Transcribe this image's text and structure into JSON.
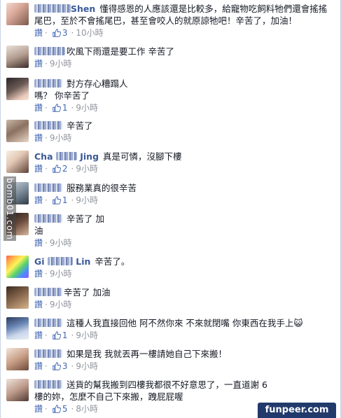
{
  "comments": [
    {
      "name_suffix": "Shen",
      "text": "懂得感恩的人應該還是比較多，給寵物吃飼料牠們還會搖搖尾巴，至於不會搖尾巴，甚至會咬人的就原諒牠吧！辛苦了，加油！",
      "like_label": "讚",
      "like_count": "3",
      "time": "10小時"
    },
    {
      "name_suffix": "",
      "text": "吹風下雨還是要工作 辛苦了",
      "like_label": "讚",
      "like_count": "",
      "time": "9小時"
    },
    {
      "name_suffix": "",
      "text": "對方存心糟蹋人嗎？ 你辛苦了",
      "like_label": "讚",
      "like_count": "1",
      "time": "9小時"
    },
    {
      "name_suffix": "",
      "text": "辛苦了",
      "like_label": "讚",
      "like_count": "",
      "time": "9小時"
    },
    {
      "name_prefix": "Cha",
      "name_suffix": "Jing",
      "text": "真是可憐，沒腳下樓",
      "like_label": "讚",
      "like_count": "2",
      "time": "9小時"
    },
    {
      "name_suffix": "",
      "text": "服務業真的很辛苦",
      "like_label": "讚",
      "like_count": "1",
      "time": "9小時"
    },
    {
      "name_suffix": "",
      "text": "辛苦了 加油",
      "like_label": "讚",
      "like_count": "",
      "time": "9小時"
    },
    {
      "name_prefix": "Gi",
      "name_suffix": "Lin",
      "text": "辛苦了。",
      "like_label": "讚",
      "like_count": "",
      "time": "9小時"
    },
    {
      "name_suffix": "",
      "text": "辛苦了 加油",
      "like_label": "讚",
      "like_count": "",
      "time": "9小時"
    },
    {
      "name_suffix": "",
      "text": "這種人我直接回他 阿不然你來 不來就閉嘴 你東西在我手上😺",
      "like_label": "讚",
      "like_count": "1",
      "time": "9小時"
    },
    {
      "name_suffix": "",
      "text": "如果是我 我就丟再一樓請她自己下來搬！",
      "like_label": "讚",
      "like_count": "3",
      "time": "9小時"
    },
    {
      "name_suffix": "",
      "text": "送貨的幫我搬到四樓我都很不好意思了，一直道謝 6樓的妳，怎麼不自己下來搬，跩屁屁喔",
      "like_label": "讚",
      "like_count": "5",
      "time": "8小時"
    }
  ],
  "watermarks": {
    "side": "bomb01.com",
    "badge": "funpeer.com"
  },
  "colors": {
    "link": "#3b5998",
    "like": "#4267b2",
    "meta": "#90949c",
    "text": "#141823"
  }
}
